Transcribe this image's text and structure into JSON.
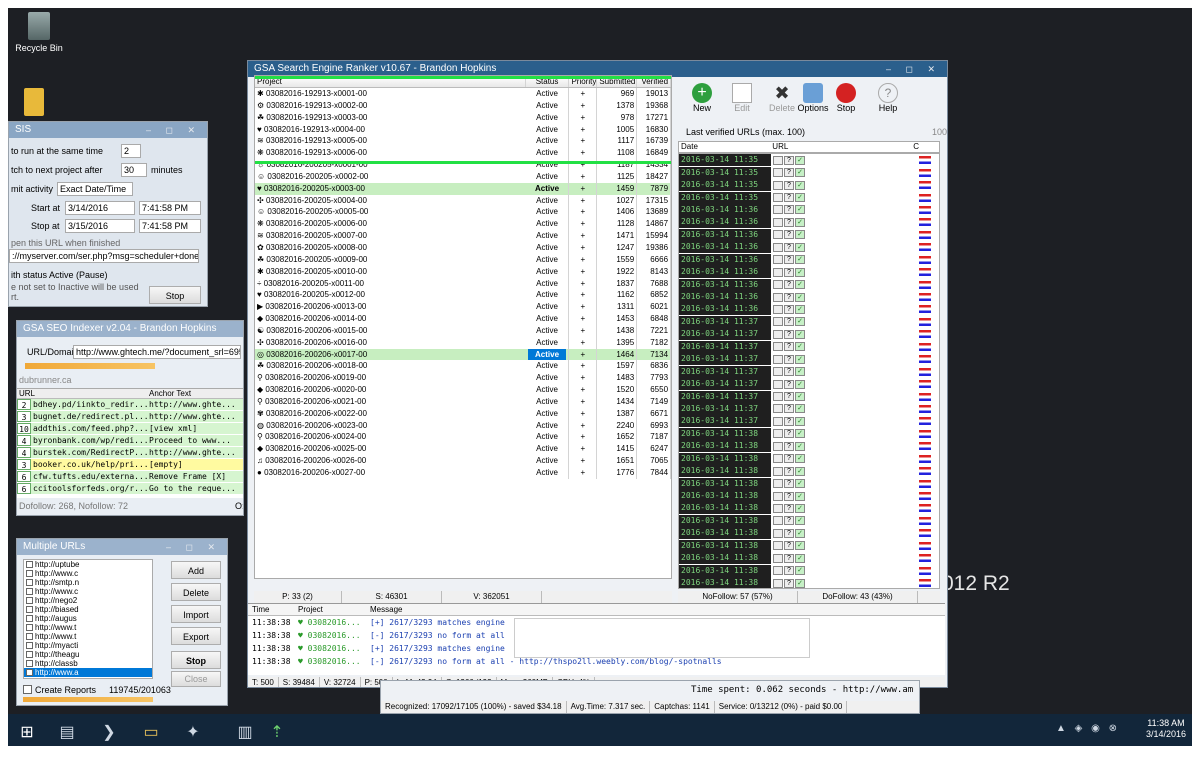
{
  "desktop": {
    "recycle_bin": "Recycle Bin",
    "server_text": "012 R2"
  },
  "main": {
    "title": "GSA Search Engine Ranker v10.67 - Brandon Hopkins",
    "toolbar": {
      "new": "New",
      "edit": "Edit",
      "delete": "Delete",
      "options": "Options",
      "stop": "Stop",
      "help": "Help"
    },
    "columns": {
      "project": "Project",
      "status": "Status",
      "priority": "Priority",
      "submitted": "Submitted",
      "verified": "Verified"
    },
    "rows": [
      {
        "i": "✱",
        "p": "03082016-192913-x0001-00",
        "s": "Active",
        "pr": "+",
        "sub": "969",
        "v": "19013"
      },
      {
        "i": "⚙",
        "p": "03082016-192913-x0002-00",
        "s": "Active",
        "pr": "+",
        "sub": "1378",
        "v": "19368"
      },
      {
        "i": "☘",
        "p": "03082016-192913-x0003-00",
        "s": "Active",
        "pr": "+",
        "sub": "978",
        "v": "17271"
      },
      {
        "i": "♥",
        "p": "03082016-192913-x0004-00",
        "s": "Active",
        "pr": "+",
        "sub": "1005",
        "v": "16830"
      },
      {
        "i": "≋",
        "p": "03082016-192913-x0005-00",
        "s": "Active",
        "pr": "+",
        "sub": "1117",
        "v": "16739"
      },
      {
        "i": "❋",
        "p": "03082016-192913-x0006-00",
        "s": "Active",
        "pr": "+",
        "sub": "1108",
        "v": "16849"
      },
      {
        "i": "☼",
        "p": "03082016-200205-x0001-00",
        "s": "Active",
        "pr": "+",
        "sub": "1187",
        "v": "14334"
      },
      {
        "i": "☺",
        "p": "03082016-200205-x0002-00",
        "s": "Active",
        "pr": "+",
        "sub": "1125",
        "v": "18427"
      },
      {
        "i": "♥",
        "p": "03082016-200205-x0003-00",
        "s": "Active",
        "pr": "+",
        "sub": "1459",
        "v": "7879",
        "sel": true
      },
      {
        "i": "✣",
        "p": "03082016-200205-x0004-00",
        "s": "Active",
        "pr": "+",
        "sub": "1027",
        "v": "17315"
      },
      {
        "i": "☺",
        "p": "03082016-200205-x0005-00",
        "s": "Active",
        "pr": "+",
        "sub": "1406",
        "v": "13689"
      },
      {
        "i": "❋",
        "p": "03082016-200205-x0006-00",
        "s": "Active",
        "pr": "+",
        "sub": "1128",
        "v": "14867"
      },
      {
        "i": "≋",
        "p": "03082016-200205-x0007-00",
        "s": "Active",
        "pr": "+",
        "sub": "1471",
        "v": "15994"
      },
      {
        "i": "✿",
        "p": "03082016-200205-x0008-00",
        "s": "Active",
        "pr": "+",
        "sub": "1247",
        "v": "19386"
      },
      {
        "i": "☘",
        "p": "03082016-200205-x0009-00",
        "s": "Active",
        "pr": "+",
        "sub": "1559",
        "v": "6666"
      },
      {
        "i": "✱",
        "p": "03082016-200205-x0010-00",
        "s": "Active",
        "pr": "+",
        "sub": "1922",
        "v": "8143"
      },
      {
        "i": "÷",
        "p": "03082016-200205-x0011-00",
        "s": "Active",
        "pr": "+",
        "sub": "1837",
        "v": "7688"
      },
      {
        "i": "♥",
        "p": "03082016-200205-x0012-00",
        "s": "Active",
        "pr": "+",
        "sub": "1162",
        "v": "6852"
      },
      {
        "i": "▶",
        "p": "03082016-200206-x0013-00",
        "s": "Active",
        "pr": "+",
        "sub": "1311",
        "v": "6021"
      },
      {
        "i": "◆",
        "p": "03082016-200206-x0014-00",
        "s": "Active",
        "pr": "+",
        "sub": "1453",
        "v": "6848"
      },
      {
        "i": "☯",
        "p": "03082016-200206-x0015-00",
        "s": "Active",
        "pr": "+",
        "sub": "1438",
        "v": "7221"
      },
      {
        "i": "✣",
        "p": "03082016-200206-x0016-00",
        "s": "Active",
        "pr": "+",
        "sub": "1395",
        "v": "7182"
      },
      {
        "i": "◎",
        "p": "03082016-200206-x0017-00",
        "s": "Active",
        "pr": "+",
        "sub": "1464",
        "v": "7134",
        "sel": true,
        "badge": true
      },
      {
        "i": "☘",
        "p": "03082016-200206-x0018-00",
        "s": "Active",
        "pr": "+",
        "sub": "1597",
        "v": "6836"
      },
      {
        "i": "⚲",
        "p": "03082016-200206-x0019-00",
        "s": "Active",
        "pr": "+",
        "sub": "1483",
        "v": "7793"
      },
      {
        "i": "◆",
        "p": "03082016-200206-x0020-00",
        "s": "Active",
        "pr": "+",
        "sub": "1520",
        "v": "6550"
      },
      {
        "i": "⚲",
        "p": "03082016-200206-x0021-00",
        "s": "Active",
        "pr": "+",
        "sub": "1434",
        "v": "7149"
      },
      {
        "i": "✾",
        "p": "03082016-200206-x0022-00",
        "s": "Active",
        "pr": "+",
        "sub": "1387",
        "v": "6671"
      },
      {
        "i": "◍",
        "p": "03082016-200206-x0023-00",
        "s": "Active",
        "pr": "+",
        "sub": "2240",
        "v": "6993"
      },
      {
        "i": "⚲",
        "p": "03082016-200206-x0024-00",
        "s": "Active",
        "pr": "+",
        "sub": "1652",
        "v": "7187"
      },
      {
        "i": "◆",
        "p": "03082016-200206-x0025-00",
        "s": "Active",
        "pr": "+",
        "sub": "1415",
        "v": "6247"
      },
      {
        "i": "♫",
        "p": "03082016-200206-x0026-00",
        "s": "Active",
        "pr": "+",
        "sub": "1651",
        "v": "7065"
      },
      {
        "i": "●",
        "p": "03082016-200206-x0027-00",
        "s": "Active",
        "pr": "+",
        "sub": "1776",
        "v": "7844"
      }
    ],
    "grid_status": {
      "p": "P: 33 (2)",
      "s": "S: 46301",
      "v": "V: 362051"
    },
    "urllog": {
      "title": "Last verified URLs (max. 100)",
      "count": "100",
      "col_date": "Date",
      "col_url": "URL",
      "col_c": "C",
      "dates": [
        "2016-03-14 11:35",
        "2016-03-14 11:35",
        "2016-03-14 11:35",
        "2016-03-14 11:35",
        "2016-03-14 11:36",
        "2016-03-14 11:36",
        "2016-03-14 11:36",
        "2016-03-14 11:36",
        "2016-03-14 11:36",
        "2016-03-14 11:36",
        "2016-03-14 11:36",
        "2016-03-14 11:36",
        "2016-03-14 11:36",
        "2016-03-14 11:37",
        "2016-03-14 11:37",
        "2016-03-14 11:37",
        "2016-03-14 11:37",
        "2016-03-14 11:37",
        "2016-03-14 11:37",
        "2016-03-14 11:37",
        "2016-03-14 11:37",
        "2016-03-14 11:37",
        "2016-03-14 11:38",
        "2016-03-14 11:38",
        "2016-03-14 11:38",
        "2016-03-14 11:38",
        "2016-03-14 11:38",
        "2016-03-14 11:38",
        "2016-03-14 11:38",
        "2016-03-14 11:38",
        "2016-03-14 11:38",
        "2016-03-14 11:38",
        "2016-03-14 11:38",
        "2016-03-14 11:38",
        "2016-03-14 11:38",
        "2016-03-14 11:38"
      ],
      "nofollow": "NoFollow: 57 (57%)",
      "dofollow": "DoFollow: 43 (43%)"
    },
    "log": {
      "col_time": "Time",
      "col_project": "Project",
      "col_message": "Message",
      "rows": [
        {
          "t": "11:38:38",
          "p": "♥ 03082016...",
          "m": "[+] 2617/3293 matches engine"
        },
        {
          "t": "11:38:38",
          "p": "♥ 03082016...",
          "m": "[-] 2617/3293 no form at all"
        },
        {
          "t": "11:38:38",
          "p": "♥ 03082016...",
          "m": "[+] 2617/3293 matches engine"
        },
        {
          "t": "11:38:38",
          "p": "♥ 03082016...",
          "m": "[-] 2617/3293 no form at all - http://thspo2ll.weebly.com/blog/-spotnalls"
        }
      ]
    },
    "statusbar": {
      "t": "T: 500",
      "s": "S: 39484",
      "v": "V: 32724",
      "p": "P: 500",
      "lpm": "LpM: 43.94",
      "c": "C: 1366 /192",
      "mem": "Mem: 360MB",
      "cpu": "CPU: 4%"
    }
  },
  "captcha": {
    "time_spent": "Time spent: 0.062 seconds - http://www.am",
    "recognized": "Recognized: 17092/17105 (100%) - saved $34.18",
    "avg": "Avg.Time: 7.317 sec.",
    "captchas": "Captchas: 1141",
    "service": "Service: 0/13212 (0%) - paid $0.00"
  },
  "scheduler": {
    "title": "SIS",
    "run_same": "to run at the same time",
    "run_same_val": "2",
    "switch": "tch to next project after",
    "switch_val": "30",
    "minutes": "minutes",
    "limit": "mit activity",
    "limit_val": "Exact Date/Time",
    "start": "Start at",
    "start_date": "3/14/2016",
    "start_time": "7:41:58 PM",
    "stop": "Stop at",
    "stop_date": "3/15/2016",
    "stop_time": "7:41:58 PM",
    "open_url": "pen this URL when finished",
    "url_val": "://myserver.com/ser.php?msg=scheduler+done",
    "status": "ith status Active (Pause)",
    "inactive": "e not set to Inactive will be used",
    "rt": "rt.",
    "stop_btn": "Stop"
  },
  "indexer": {
    "title": "GSA SEO Indexer v2.04 - Brandon Hopkins",
    "url_label": "URL/Domain",
    "url_val": "http://www.ghtech.me/?document_srl=695537",
    "domain": "dubrunner.ca",
    "col_url": "URL",
    "col_anchor": "Anchor Text",
    "rows": [
      {
        "n": "2",
        "u": "bdhey.pd/iinkto_redir...",
        "a": "http://www.ghte..."
      },
      {
        "n": "3",
        "u": "bugnet.de/redirect.pl...",
        "a": "http://www.ghte..."
      },
      {
        "n": "10",
        "u": "addthis.com/feed.php?...",
        "a": "[view xml]"
      },
      {
        "n": "4",
        "u": "byronbank.com/wp/redi...",
        "a": "Proceed to www..."
      },
      {
        "n": "4",
        "u": "burstek.com/RedirectP...",
        "a": "http://www.ghte..."
      },
      {
        "n": "3",
        "u": "booker.co.uk/help/pri...",
        "a": "[empty]"
      },
      {
        "n": "6",
        "u": "cfw.tufts.edu/externa...",
        "a": "Remove Frame [X]"
      },
      {
        "n": "6",
        "u": "ccitoolsforfeds.org/r...",
        "a": "Go to the reque..."
      }
    ],
    "footer": "Dofollow: 268, Nofollow: 72",
    "footer_right": "O:"
  },
  "multi": {
    "title": "Multiple URLs",
    "items": [
      "http://uptube",
      "http://www.c",
      "http://smtp.n",
      "http://www.c",
      "http://nego2",
      "http://biased",
      "http://augus",
      "http://www.t",
      "http://www.t",
      "http://myacti",
      "http://theagu",
      "http://classb",
      "http://www.a"
    ],
    "add": "Add",
    "delete": "Delete",
    "import": "Import",
    "export": "Export",
    "stop": "Stop",
    "close": "Close",
    "create_reports": "Create Reports",
    "count": "119745/201063"
  },
  "taskbar": {
    "time": "11:38 AM",
    "date": "3/14/2016"
  }
}
